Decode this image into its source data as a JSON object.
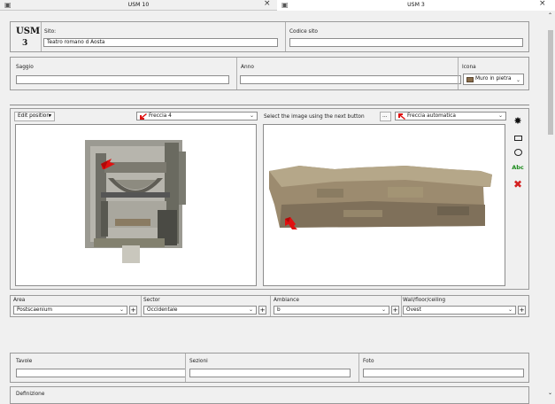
{
  "tabs": [
    {
      "title": "USM 10",
      "close": "×"
    },
    {
      "title": "USM 3",
      "close": "×"
    }
  ],
  "header": {
    "usm_label": "USM",
    "usm_number": "3",
    "sito_label": "Sito:",
    "sito_value": "Teatro romano d Aosta",
    "codice_label": "Codice sito",
    "codice_value": ""
  },
  "row2": {
    "saggio_label": "Saggio",
    "saggio_value": "",
    "anno_label": "Anno",
    "anno_value": "",
    "icona_label": "Icona",
    "icona_value": "Muro in pietra"
  },
  "image_panel": {
    "edit_position": "Edit position",
    "freccia_left": "Freccia 4",
    "select_hint": "Select the image using the next button",
    "browse_btn": "...",
    "freccia_right": "Freccia automatica",
    "tool_text": "Abc"
  },
  "fields": {
    "area_label": "Area",
    "area_value": "Postscaenium",
    "sector_label": "Sector",
    "sector_value": "Occidentale",
    "ambiance_label": "Ambiance",
    "ambiance_value": "b",
    "wall_label": "Wall/floor/ceiling",
    "wall_value": "Ovest",
    "plus": "+"
  },
  "row4": {
    "tavole_label": "Tavole",
    "tavole_value": "",
    "sezioni_label": "Sezioni",
    "sezioni_value": "",
    "foto_label": "Foto",
    "foto_value": ""
  },
  "definizione_label": "Definizione",
  "colors": {
    "arrow": "#e01010",
    "abc": "#1a8a1a",
    "delete": "#d42020"
  }
}
